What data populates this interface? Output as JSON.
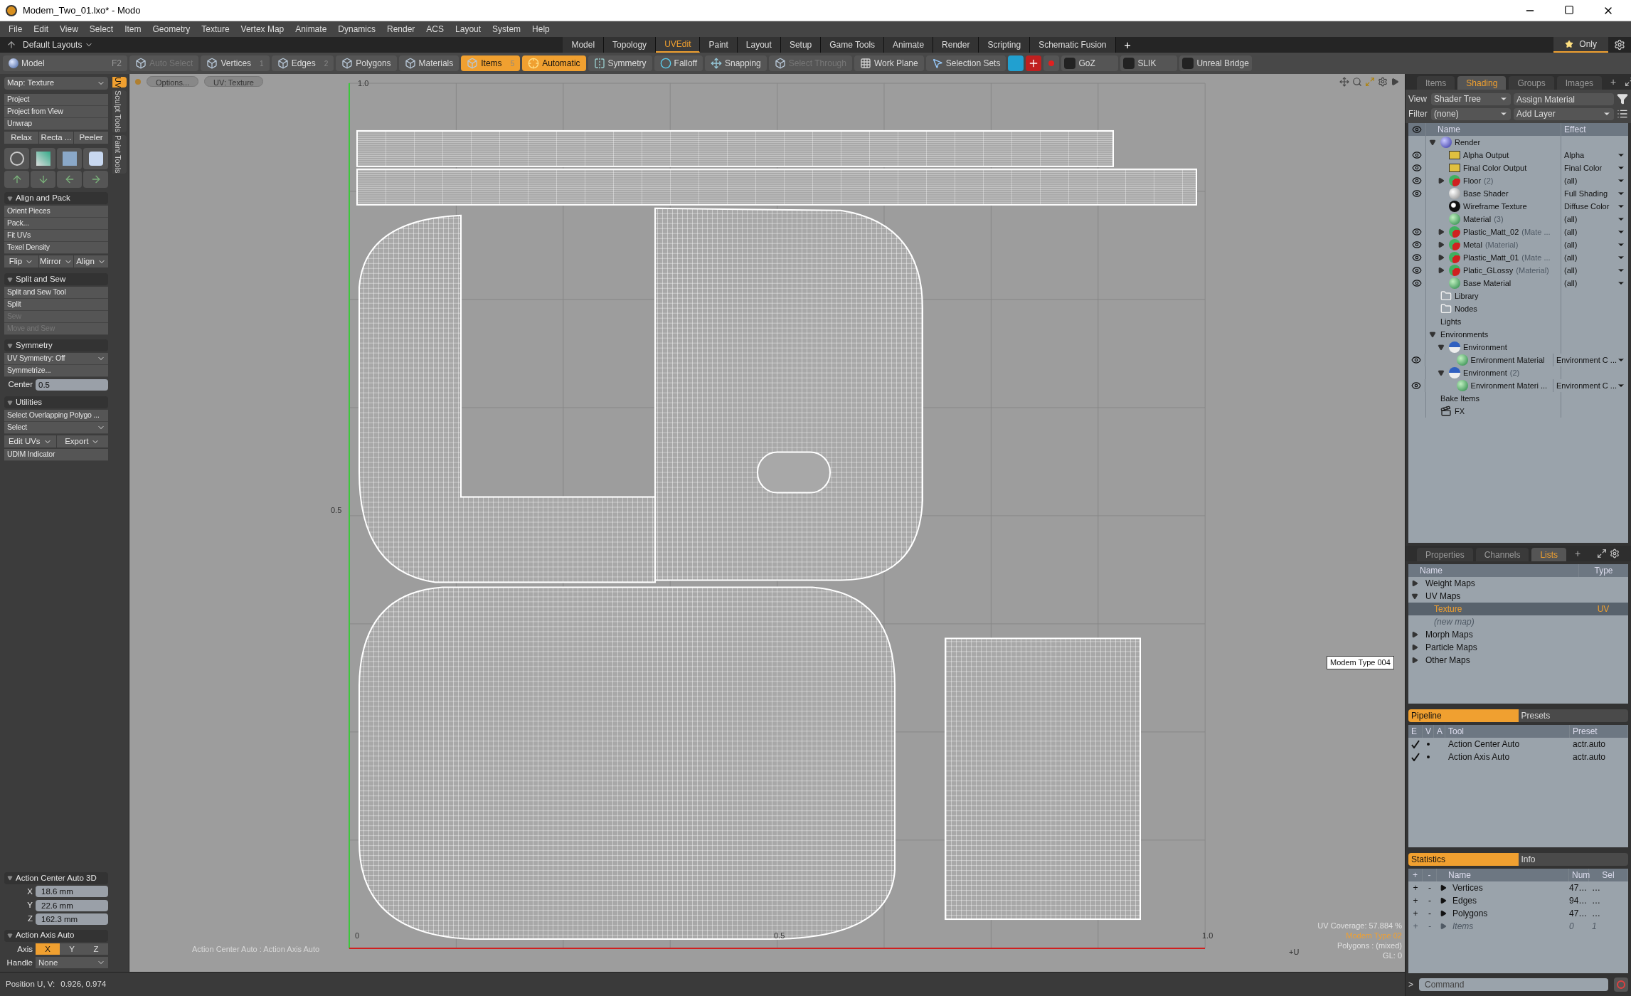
{
  "window": {
    "title": "Modem_Two_01.lxo* - Modo"
  },
  "menu": [
    "File",
    "Edit",
    "View",
    "Select",
    "Item",
    "Geometry",
    "Texture",
    "Vertex Map",
    "Animate",
    "Dynamics",
    "Render",
    "ACS",
    "Layout",
    "System",
    "Help"
  ],
  "layout_bar": {
    "preset": "Default Layouts",
    "tabs": [
      {
        "label": "Model",
        "selected": false
      },
      {
        "label": "Topology",
        "selected": false
      },
      {
        "label": "UVEdit",
        "selected": true
      },
      {
        "label": "Paint",
        "selected": false
      },
      {
        "label": "Layout",
        "selected": false
      },
      {
        "label": "Setup",
        "selected": false
      },
      {
        "label": "Game Tools",
        "selected": false
      },
      {
        "label": "Animate",
        "selected": false
      },
      {
        "label": "Render",
        "selected": false
      },
      {
        "label": "Scripting",
        "selected": false
      },
      {
        "label": "Schematic Fusion",
        "selected": false
      }
    ],
    "add": "+",
    "only": "Only"
  },
  "toolbar": {
    "mode": "Model",
    "mode_key": "F2",
    "tools": [
      {
        "label": "Auto Select",
        "kind": "cube",
        "selected": false,
        "disabled": true
      },
      {
        "label": "Vertices",
        "key": "1",
        "kind": "cube",
        "selected": false,
        "disabled": false
      },
      {
        "label": "Edges",
        "key": "2",
        "kind": "cube",
        "selected": false,
        "disabled": false
      },
      {
        "label": "Polygons",
        "kind": "cube",
        "selected": false,
        "disabled": false
      },
      {
        "label": "Materials",
        "kind": "cube",
        "selected": false,
        "disabled": false
      },
      {
        "label": "Items",
        "key": "5",
        "kind": "cube",
        "selected": true,
        "disabled": false
      },
      {
        "label": "Automatic",
        "kind": "target",
        "selected": true,
        "disabled": false
      },
      {
        "label": "Symmetry",
        "kind": "mirror",
        "selected": false,
        "disabled": false
      },
      {
        "label": "Falloff",
        "kind": "ring",
        "selected": false,
        "disabled": false
      },
      {
        "label": "Snapping",
        "kind": "cross",
        "selected": false,
        "disabled": false
      },
      {
        "label": "Select Through",
        "kind": "cube",
        "selected": false,
        "disabled": true
      },
      {
        "label": "Work Plane",
        "kind": "plane",
        "selected": false,
        "disabled": false
      },
      {
        "label": "Selection Sets",
        "kind": "arrow",
        "selected": false,
        "disabled": false
      }
    ],
    "plugins": [
      {
        "label": "GoZ"
      },
      {
        "label": "SLIK"
      },
      {
        "label": "Unreal Bridge"
      }
    ]
  },
  "left_panel": {
    "map": "Map: Texture",
    "side_tabs": [
      {
        "label": "UV",
        "selected": true
      },
      {
        "label": "Sculpt Tools",
        "selected": false
      },
      {
        "label": "Paint Tools",
        "selected": false
      }
    ],
    "top_buttons": [
      "Project",
      "Project from View",
      "Unwrap"
    ],
    "row_buttons": [
      "Relax",
      "Recta ...",
      "Peeler"
    ],
    "sections": [
      {
        "title": "Align and Pack",
        "items": [
          {
            "kind": "button",
            "label": "Orient Pieces"
          },
          {
            "kind": "button",
            "label": "Pack..."
          },
          {
            "kind": "button",
            "label": "Fit UVs"
          },
          {
            "kind": "button",
            "label": "Texel Density"
          },
          {
            "kind": "row",
            "labels": [
              "Flip",
              "Mirror",
              "Align"
            ]
          }
        ]
      },
      {
        "title": "Split and Sew",
        "items": [
          {
            "kind": "button",
            "label": "Split and Sew Tool"
          },
          {
            "kind": "button",
            "label": "Split"
          },
          {
            "kind": "disabled",
            "label": "Sew"
          },
          {
            "kind": "disabled",
            "label": "Move and Sew"
          }
        ]
      },
      {
        "title": "Symmetry",
        "items": [
          {
            "kind": "dropdown",
            "label": "UV Symmetry: Off"
          },
          {
            "kind": "button",
            "label": "Symmetrize..."
          },
          {
            "kind": "field",
            "label": "Center",
            "value": "0.5"
          }
        ]
      },
      {
        "title": "Utilities",
        "items": [
          {
            "kind": "button",
            "label": "Select Overlapping Polygo ..."
          },
          {
            "kind": "dropdown",
            "label": "Select"
          },
          {
            "kind": "row",
            "labels": [
              "Edit UVs",
              "Export"
            ]
          },
          {
            "kind": "button",
            "label": "UDIM Indicator"
          }
        ]
      }
    ],
    "action_center": {
      "title": "Action Center Auto 3D",
      "fields": [
        {
          "label": "X",
          "value": "18.6 mm"
        },
        {
          "label": "Y",
          "value": "22.6 mm"
        },
        {
          "label": "Z",
          "value": "162.3 mm"
        }
      ]
    },
    "action_axis": {
      "title": "Action Axis Auto",
      "axis_label": "Axis",
      "axes": [
        {
          "label": "X",
          "selected": true
        },
        {
          "label": "Y",
          "selected": false
        },
        {
          "label": "Z",
          "selected": false
        }
      ],
      "handle_label": "Handle",
      "handle": "None"
    }
  },
  "viewport": {
    "buttons": [
      "Options...",
      "UV: Texture"
    ],
    "v_ticks": [
      "1.0",
      "0.5"
    ],
    "u_ticks": [
      "0",
      "0.5",
      "1.0"
    ],
    "u_axis": "+U",
    "tooltip": "Modem Type 004",
    "action_info": "Action Center Auto : Action Axis Auto",
    "info": [
      {
        "text": "UV Coverage: 57.884 %",
        "highlight": false
      },
      {
        "text": "Modem Type 02",
        "highlight": true
      },
      {
        "text": "Polygons : (mixed)",
        "highlight": false
      },
      {
        "text": "GL: 0",
        "highlight": false
      }
    ]
  },
  "status_bar": {
    "label": "Position U, V:",
    "value": "0.926, 0.974"
  },
  "shading_panel": {
    "tabs": [
      {
        "label": "Items",
        "selected": false
      },
      {
        "label": "Shading",
        "selected": true
      },
      {
        "label": "Groups",
        "selected": false
      },
      {
        "label": "Images",
        "selected": false
      }
    ],
    "add": "+",
    "view_label": "View",
    "view": "Shader Tree",
    "assign": "Assign Material",
    "filter_label": "Filter",
    "filter": "(none)",
    "add_layer": "Add Layer",
    "columns": [
      "Name",
      "Effect"
    ],
    "tree": [
      {
        "name": "Render",
        "kind": "sphere",
        "visible": false,
        "expanded": true,
        "children": [
          {
            "name": "Alpha Output",
            "kind": "output",
            "visible": true,
            "effect": "Alpha"
          },
          {
            "name": "Final Color Output",
            "kind": "output",
            "visible": true,
            "effect": "Final Color"
          },
          {
            "name": "Floor",
            "suffix": "(2)",
            "kind": "mask",
            "visible": true,
            "expanded": false,
            "effect": "(all)"
          },
          {
            "name": "Base Shader",
            "kind": "shader",
            "visible": true,
            "effect": "Full Shading"
          },
          {
            "name": "Wireframe Texture",
            "kind": "texture",
            "visible": false,
            "effect": "Diffuse Color"
          },
          {
            "name": "Material",
            "suffix": "(3)",
            "kind": "material",
            "visible": false,
            "effect": "(all)"
          },
          {
            "name": "Plastic_Matt_02",
            "suffix": "(Mate ...",
            "kind": "mask",
            "visible": true,
            "expanded": false,
            "effect": "(all)"
          },
          {
            "name": "Metal",
            "suffix": "(Material)",
            "kind": "mask",
            "visible": true,
            "expanded": false,
            "effect": "(all)"
          },
          {
            "name": "Plastic_Matt_01",
            "suffix": "(Mate ...",
            "kind": "mask",
            "visible": true,
            "expanded": false,
            "effect": "(all)"
          },
          {
            "name": "Platic_GLossy",
            "suffix": "(Material)",
            "kind": "mask",
            "visible": true,
            "expanded": false,
            "effect": "(all)"
          },
          {
            "name": "Base Material",
            "kind": "material",
            "visible": true,
            "effect": "(all)"
          }
        ]
      },
      {
        "name": "Library",
        "kind": "folder",
        "visible": false
      },
      {
        "name": "Nodes",
        "kind": "folder",
        "visible": false
      },
      {
        "name": "Lights",
        "kind": "group",
        "visible": false
      },
      {
        "name": "Environments",
        "kind": "group",
        "visible": false,
        "expanded": true,
        "children": [
          {
            "name": "Environment",
            "kind": "environment",
            "visible": false,
            "expanded": true,
            "children": [
              {
                "name": "Environment Material",
                "kind": "material",
                "visible": true,
                "effect": "Environment C ..."
              }
            ]
          },
          {
            "name": "Environment",
            "suffix": "(2)",
            "kind": "environment",
            "visible": false,
            "expanded": true,
            "children": [
              {
                "name": "Environment Materi ...",
                "kind": "material",
                "visible": true,
                "effect": "Environment C ..."
              }
            ]
          }
        ]
      },
      {
        "name": "Bake Items",
        "kind": "group",
        "visible": false
      },
      {
        "name": "FX",
        "kind": "clapper",
        "visible": false
      }
    ]
  },
  "lists_panel": {
    "tabs": [
      {
        "label": "Properties",
        "selected": false
      },
      {
        "label": "Channels",
        "selected": false
      },
      {
        "label": "Lists",
        "selected": true
      }
    ],
    "add": "+",
    "columns": [
      "Name",
      "Type"
    ],
    "rows": [
      {
        "name": "Weight Maps",
        "expanded": false
      },
      {
        "name": "UV Maps",
        "expanded": true,
        "children": [
          {
            "name": "Texture",
            "type": "UV",
            "selected": true
          },
          {
            "name": "(new map)",
            "selected": false,
            "disabled": true
          }
        ]
      },
      {
        "name": "Morph Maps",
        "expanded": false
      },
      {
        "name": "Particle Maps",
        "expanded": false
      },
      {
        "name": "Other Maps",
        "expanded": false
      }
    ]
  },
  "pipeline_panel": {
    "tabs": [
      {
        "label": "Pipeline",
        "selected": true
      },
      {
        "label": "Presets",
        "selected": false
      }
    ],
    "columns": [
      "E",
      "V",
      "A",
      "Tool",
      "Preset"
    ],
    "rows": [
      {
        "enabled": true,
        "visible": true,
        "tool": "Action Center Auto",
        "preset": "actr.auto"
      },
      {
        "enabled": true,
        "visible": true,
        "tool": "Action Axis Auto",
        "preset": "actr.auto"
      }
    ]
  },
  "statistics_panel": {
    "tabs": [
      {
        "label": "Statistics",
        "selected": true
      },
      {
        "label": "Info",
        "selected": false
      }
    ],
    "columns": [
      "+",
      "-",
      "Name",
      "Num",
      "Sel"
    ],
    "rows": [
      {
        "add": "+",
        "remove": "-",
        "name": "Vertices",
        "num": "47…",
        "sel": "…",
        "disabled": false
      },
      {
        "add": "+",
        "remove": "-",
        "name": "Edges",
        "num": "94…",
        "sel": "…",
        "disabled": false
      },
      {
        "add": "+",
        "remove": "-",
        "name": "Polygons",
        "num": "47…",
        "sel": "…",
        "disabled": false
      },
      {
        "add": "+",
        "remove": "-",
        "name": "Items",
        "num": "0",
        "sel": "1",
        "disabled": true
      }
    ]
  },
  "command": {
    "prompt": ">",
    "placeholder": "Command"
  }
}
